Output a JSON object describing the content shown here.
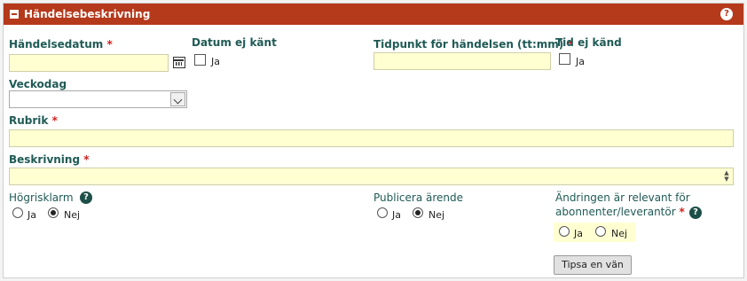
{
  "header": {
    "title": "Händelsebeskrivning"
  },
  "form": {
    "event_date": {
      "label": "Händelsedatum",
      "required": "*",
      "value": ""
    },
    "date_unknown": {
      "label": "Datum ej känt",
      "option": "Ja",
      "checked": false
    },
    "event_time": {
      "label": "Tidpunkt för händelsen (tt:mm)",
      "required": "*",
      "value": ""
    },
    "time_unknown": {
      "label": "Tid ej känd",
      "option": "Ja",
      "checked": false
    },
    "weekday": {
      "label": "Veckodag",
      "selected": ""
    },
    "subject": {
      "label": "Rubrik",
      "required": "*",
      "value": ""
    },
    "description": {
      "label": "Beskrivning",
      "required": "*",
      "value": ""
    },
    "high_risk_alarm": {
      "label": "Högrisklarm",
      "options": [
        "Ja",
        "Nej"
      ],
      "selected": "Nej"
    },
    "publish_case": {
      "label": "Publicera ärende",
      "options": [
        "Ja",
        "Nej"
      ],
      "selected": "Nej"
    },
    "relevant_change": {
      "label_line1": "Ändringen är relevant för",
      "label_line2": "abonnenter/leverantör",
      "required": "*",
      "options": [
        "Ja",
        "Nej"
      ],
      "selected": ""
    },
    "tip_button": "Tipsa en vän"
  },
  "colors": {
    "header_bg": "#b5391b",
    "label": "#1f5a55",
    "required": "#d42020",
    "field_bg": "#ffffd2"
  },
  "icons": [
    "collapse-icon",
    "help-icon",
    "calendar-icon",
    "chevron-down-icon"
  ]
}
